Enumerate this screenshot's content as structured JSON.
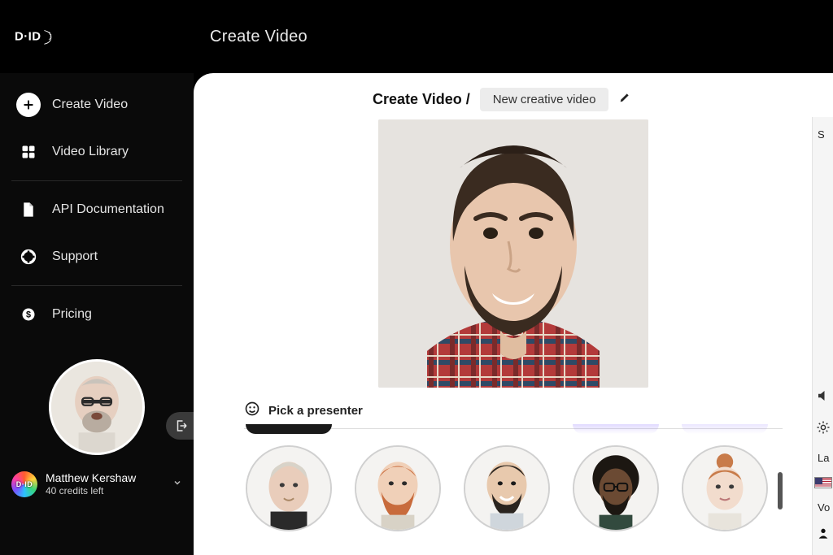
{
  "brand": "D-ID",
  "header": {
    "title": "Create Video"
  },
  "sidebar": {
    "items": [
      {
        "label": "Create Video"
      },
      {
        "label": "Video Library"
      },
      {
        "label": "API Documentation"
      },
      {
        "label": "Support"
      },
      {
        "label": "Pricing"
      }
    ]
  },
  "user": {
    "name": "Matthew Kershaw",
    "credits_label": "40 credits left",
    "logo_text": "D·ID"
  },
  "breadcrumb": {
    "root": "Create Video /",
    "title": "New creative video"
  },
  "picker": {
    "heading": "Pick a presenter",
    "presenters": [
      {
        "name": "presenter-1",
        "skin": "#e9cdbb",
        "hair": "#d8d3c9",
        "hair_shape": "short"
      },
      {
        "name": "presenter-2",
        "skin": "#f0d0b8",
        "hair": "#c86b3c",
        "hair_shape": "beard"
      },
      {
        "name": "presenter-3",
        "skin": "#e8c9ad",
        "hair": "#2a241f",
        "hair_shape": "short-beard"
      },
      {
        "name": "presenter-4",
        "skin": "#6b4a33",
        "hair": "#1c1712",
        "hair_shape": "afro"
      },
      {
        "name": "presenter-5",
        "skin": "#f2dccd",
        "hair": "#c87b4a",
        "hair_shape": "bun"
      }
    ]
  },
  "preview": {
    "skin": "#e8c6ad",
    "hair": "#3a2b20",
    "shirt1": "#b33a3a",
    "shirt2": "#2f4a66"
  },
  "rightrail": {
    "top_label": "S",
    "lang_label": "La",
    "voice_label": "Vo"
  },
  "sidebar_avatar": {
    "skin": "#e6cfc0",
    "bg": "#eae6df"
  }
}
